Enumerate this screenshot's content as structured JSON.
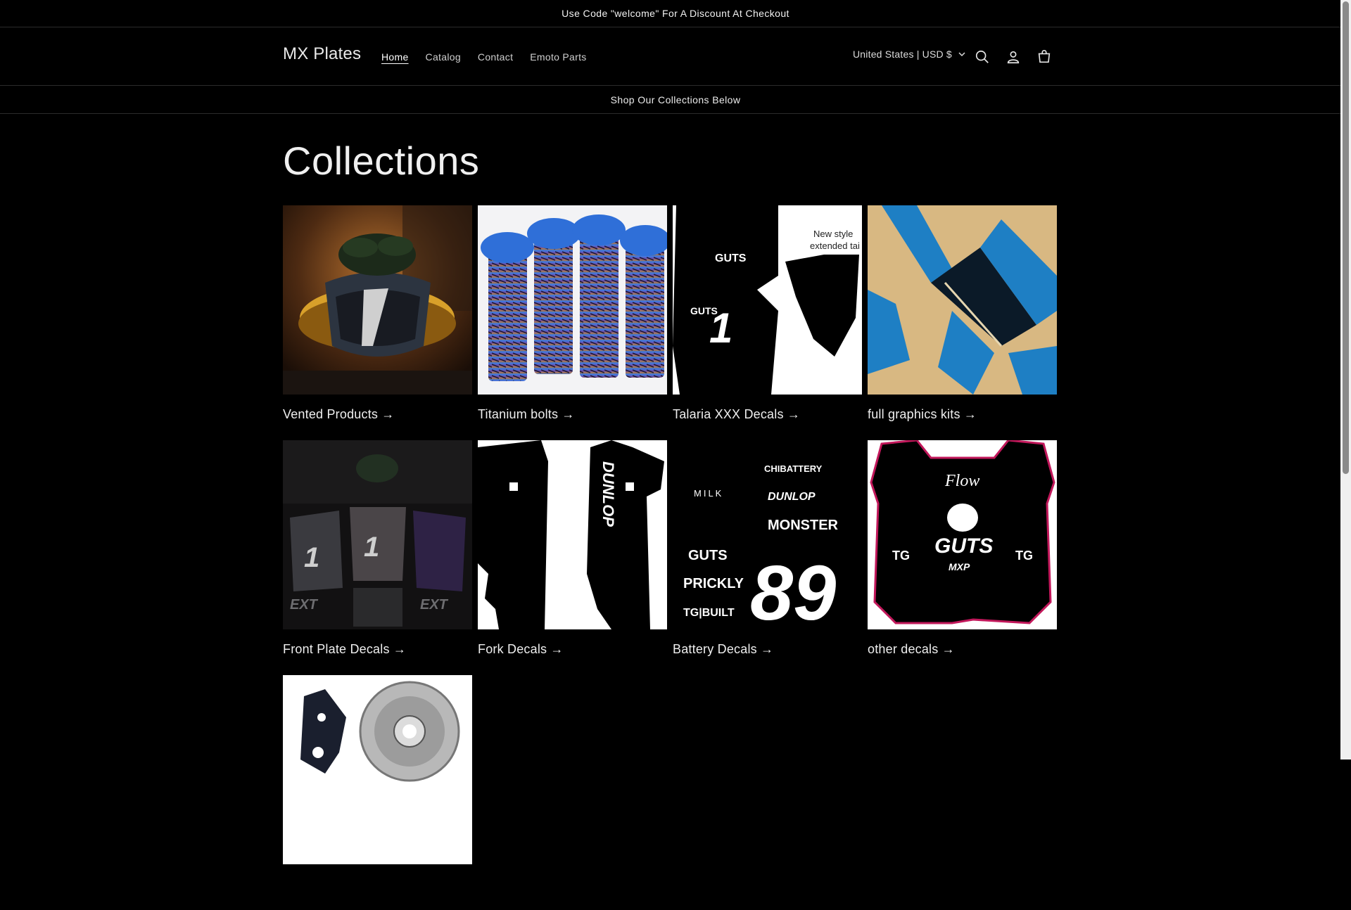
{
  "announcement": "Use Code \"welcome\" For A Discount At Checkout",
  "header": {
    "logo": "MX Plates",
    "nav": [
      {
        "label": "Home",
        "active": true
      },
      {
        "label": "Catalog",
        "active": false
      },
      {
        "label": "Contact",
        "active": false
      },
      {
        "label": "Emoto Parts",
        "active": false
      }
    ],
    "locale": "United States | USD $",
    "icons": [
      "search-icon",
      "account-icon",
      "cart-icon",
      "chevron-down-icon"
    ]
  },
  "sub_banner": "Shop Our Collections Below",
  "page_title": "Collections",
  "collections": [
    {
      "title": "Vented Products →"
    },
    {
      "title": "Titanium bolts →"
    },
    {
      "title": "Talaria XXX Decals →"
    },
    {
      "title": "full graphics kits →"
    },
    {
      "title": "Front Plate Decals →"
    },
    {
      "title": "Fork Decals →"
    },
    {
      "title": "Battery Decals →"
    },
    {
      "title": "other decals →"
    },
    {
      "title": ""
    }
  ],
  "image_text": {
    "talaria_note_1": "New style",
    "talaria_note_2": "extended tai",
    "battery": [
      "CHIBATTERY",
      "MILK",
      "DUNLOP",
      "MONSTER",
      "GUTS",
      "PRICKLY",
      "TG|BUILT",
      "89"
    ],
    "fork": "DUNLOP",
    "other": [
      "Flow",
      "GUTS",
      "MXP",
      "TG"
    ]
  },
  "colors": {
    "background": "#000000",
    "text": "#ffffff",
    "muted_text": "#cfcfcf",
    "divider": "#2b2b2b",
    "titanium_blue": "#2f6fd8",
    "titanium_purple": "#6a4aa8",
    "graphics_blue": "#1e7fc4",
    "graphics_tan": "#d8b882",
    "decal_pink_outline": "#c2185b"
  }
}
